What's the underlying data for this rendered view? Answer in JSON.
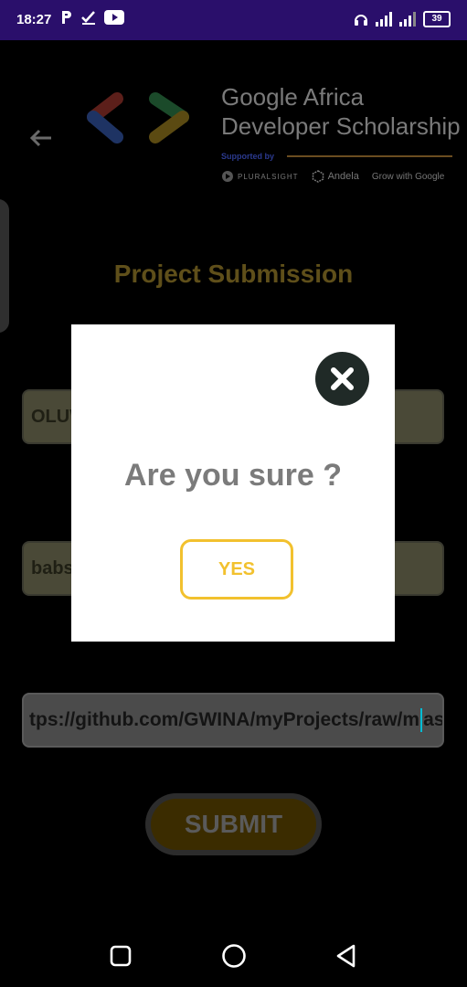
{
  "status_bar": {
    "time": "18:27",
    "battery": "39",
    "icons": [
      "p-icon",
      "check-icon",
      "youtube-icon",
      "headset-icon",
      "signal-icon",
      "signal-icon-2",
      "battery-icon"
    ]
  },
  "header": {
    "brand_line1_bold": "Google",
    "brand_line1_rest": " Africa",
    "brand_line2": "Developer Scholarship",
    "supported_by": "Supported by",
    "partners": [
      "PLURALSIGHT",
      "Andela",
      "Grow with Google"
    ]
  },
  "page": {
    "title": "Project Submission",
    "name_value": "OLUW",
    "username_value": "babs",
    "link_before_cursor": "tps://github.com/GWINA/myProjects/raw/m",
    "link_after_cursor": "as",
    "submit_label": "SUBMIT"
  },
  "dialog": {
    "question": "Are you sure ?",
    "yes_label": "YES"
  },
  "colors": {
    "status_bar": "#2a0f6b",
    "accent_yellow": "#f2c12e",
    "title_gold": "#5f4f1a",
    "dialog_bg": "#ffffff"
  }
}
